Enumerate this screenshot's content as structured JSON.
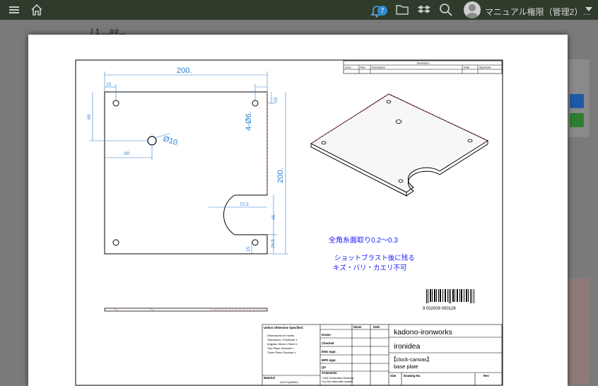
{
  "topbar": {
    "notification_count": "7",
    "user_name": "マニュアル権限（管理2）…",
    "icons": [
      "menu-icon",
      "home-icon",
      "bell-icon",
      "folder-icon",
      "dropbox-icon",
      "search-icon",
      "user-avatar",
      "chevron-down-icon"
    ]
  },
  "drawing": {
    "revisions_title": "Revisions",
    "revisions_cols": [
      "Zone",
      "Rev",
      "Description",
      "Date",
      "Approved"
    ],
    "dims": {
      "width_top": "200.",
      "d15_top": "15",
      "d15_right": "15",
      "d60_left": "60",
      "d60_bottom": "60",
      "hole_big": "Ø10.",
      "hole_small": "4-Ø6.",
      "height_right": "200.",
      "slot_width": "72.5",
      "d45": "45",
      "d15_bottom": "15",
      "d26_9": "26.9"
    },
    "notes": {
      "chamfer": "全角糸面取り0.2～0.3",
      "blast_1": "ショットブラスト後に残る",
      "blast_2": "キズ・バリ・カエリ不可"
    },
    "barcode_text": "9 002009 000128",
    "title_block": {
      "tolerance_title": "Unless Otherwise Specified:",
      "tolerance_lines": [
        "Dimensions in Inches",
        "Tolerances: Fractional   ±",
        "Angular: Mach ±   Bend   ±",
        "Two Place Decimal    ±",
        "Three Place Decimal    ±"
      ],
      "material_label": "Material",
      "material_value": "A2017(A5052)",
      "name_header": "Name",
      "date_header": "Date",
      "rows": [
        "Drawn",
        "Checked",
        "ENG Appr.",
        "MFR Appr.",
        "QA",
        "Comments"
      ],
      "comments": [
        "CAD Generated Drawing",
        "Do Not Manually Update"
      ],
      "company": "kadono-ironworks",
      "brand": "ironidea",
      "project": "【clock-canvas】",
      "part_name": "base plate",
      "size_label": "Size",
      "drawing_no_label": "Drawing  No.",
      "rev_label": "Rev"
    }
  },
  "background": {
    "page_title": "/ 1 ...##..."
  }
}
